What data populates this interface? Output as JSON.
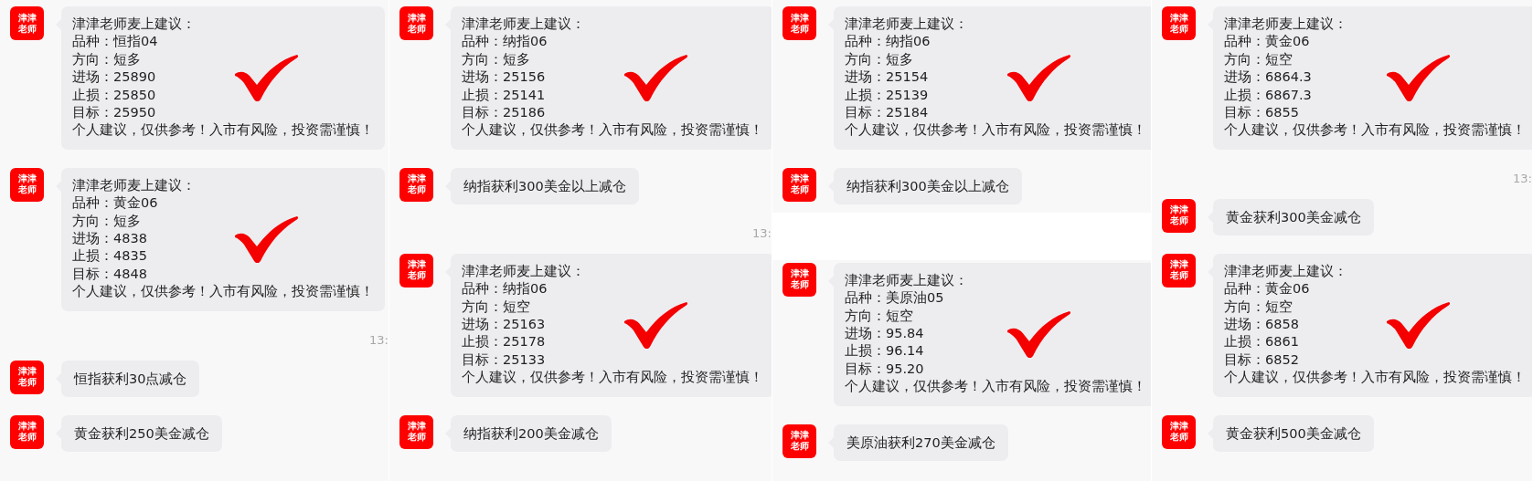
{
  "panels": [
    {
      "items": [
        {
          "kind": "signal",
          "avatar": "津津老师",
          "checked": true,
          "lines": [
            "津津老师麦上建议：",
            "品种：恒指04",
            "方向：短多",
            "进场：25890",
            "止损：25850",
            "目标：25950",
            "个人建议，仅供参考！入市有风险，投资需谨慎！"
          ]
        },
        {
          "kind": "signal",
          "avatar": "津津老师",
          "checked": true,
          "lines": [
            "津津老师麦上建议：",
            "品种：黄金06",
            "方向：短多",
            "进场：4838",
            "止损：4835",
            "目标：4848",
            "个人建议，仅供参考！入市有风险，投资需谨慎！"
          ]
        },
        {
          "kind": "time",
          "text": "13:"
        },
        {
          "kind": "note",
          "avatar": "津津老师",
          "text": "恒指获利30点减仓"
        },
        {
          "kind": "note",
          "avatar": "津津老师",
          "text": "黄金获利250美金减仓"
        }
      ]
    },
    {
      "items": [
        {
          "kind": "signal",
          "avatar": "津津老师",
          "checked": true,
          "lines": [
            "津津老师麦上建议：",
            "品种：纳指06",
            "方向：短多",
            "进场：25156",
            "止损：25141",
            "目标：25186",
            "个人建议，仅供参考！入市有风险，投资需谨慎！"
          ]
        },
        {
          "kind": "note",
          "avatar": "津津老师",
          "text": "纳指获利300美金以上减仓"
        },
        {
          "kind": "time",
          "text": "13:"
        },
        {
          "kind": "signal",
          "avatar": "津津老师",
          "checked": true,
          "lines": [
            "津津老师麦上建议：",
            "品种：纳指06",
            "方向：短空",
            "进场：25163",
            "止损：25178",
            "目标：25133",
            "个人建议，仅供参考！入市有风险，投资需谨慎！"
          ]
        },
        {
          "kind": "note",
          "avatar": "津津老师",
          "text": "纳指获利200美金减仓"
        }
      ]
    },
    {
      "items": [
        {
          "kind": "signal",
          "avatar": "津津老师",
          "checked": true,
          "lines": [
            "津津老师麦上建议：",
            "品种：纳指06",
            "方向：短多",
            "进场：25154",
            "止损：25139",
            "目标：25184",
            "个人建议，仅供参考！入市有风险，投资需谨慎！"
          ]
        },
        {
          "kind": "note",
          "avatar": "津津老师",
          "text": "纳指获利300美金以上减仓"
        },
        {
          "kind": "break"
        },
        {
          "kind": "signal",
          "avatar": "津津老师",
          "checked": true,
          "lines": [
            "津津老师麦上建议：",
            "品种：美原油05",
            "方向：短空",
            "进场：95.84",
            "止损：96.14",
            "目标：95.20",
            "个人建议，仅供参考！入市有风险，投资需谨慎！"
          ]
        },
        {
          "kind": "note",
          "avatar": "津津老师",
          "text": "美原油获利270美金减仓"
        }
      ]
    },
    {
      "items": [
        {
          "kind": "signal",
          "avatar": "津津老师",
          "checked": true,
          "lines": [
            "津津老师麦上建议：",
            "品种：黄金06",
            "方向：短空",
            "进场：6864.3",
            "止损：6867.3",
            "目标：6855",
            "个人建议，仅供参考！入市有风险，投资需谨慎！"
          ]
        },
        {
          "kind": "time",
          "text": "13:"
        },
        {
          "kind": "note",
          "avatar": "津津老师",
          "text": "黄金获利300美金减仓"
        },
        {
          "kind": "signal",
          "avatar": "津津老师",
          "checked": true,
          "lines": [
            "津津老师麦上建议：",
            "品种：黄金06",
            "方向：短空",
            "进场：6858",
            "止损：6861",
            "目标：6852",
            "个人建议，仅供参考！入市有风险，投资需谨慎！"
          ]
        },
        {
          "kind": "note",
          "avatar": "津津老师",
          "text": "黄金获利500美金减仓"
        }
      ]
    }
  ]
}
